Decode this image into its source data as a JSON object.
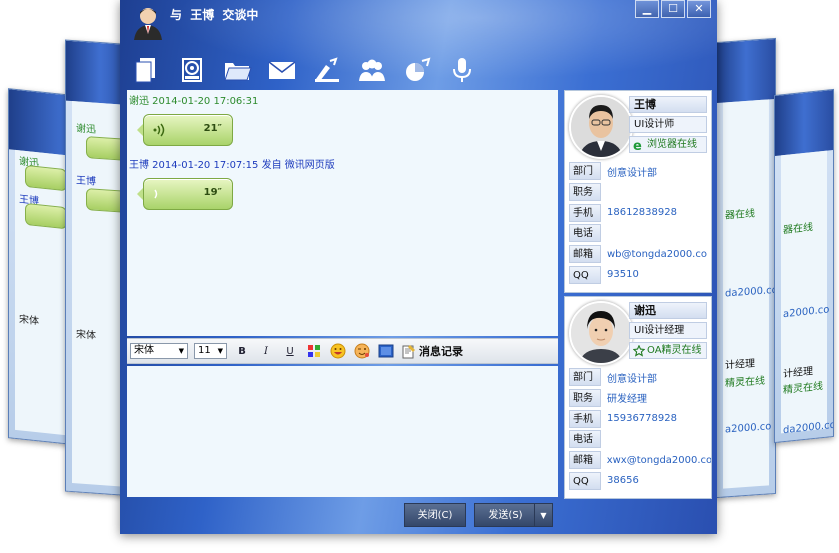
{
  "window": {
    "title_prefix": "与",
    "title_name": "王博",
    "title_suffix": "交谈中",
    "min_label": "▁",
    "max_label": "☐",
    "close_label": "✕"
  },
  "toolbar": {
    "icons": [
      "files-icon",
      "hard-disk-icon",
      "folder-icon",
      "mail-icon",
      "broadcast-icon",
      "group-icon",
      "chart-icon",
      "microphone-icon"
    ]
  },
  "messages": [
    {
      "header": "谢迅 2014-01-20 17:06:31",
      "duration": "21″"
    },
    {
      "header": "王博 2014-01-20 17:07:15 发自 微讯网页版",
      "duration": "19″"
    }
  ],
  "format_bar": {
    "font": "宋体",
    "size": "11",
    "bold": "B",
    "italic": "I",
    "underline": "U",
    "history_label": "消息记录"
  },
  "buttons": {
    "close_label": "关闭(C)",
    "send_label": "发送(S)",
    "send_arrow": "▼"
  },
  "contacts": [
    {
      "name": "王博",
      "role": "UI设计师",
      "status": "浏览器在线",
      "status_icon": "browser-e-icon",
      "fields": [
        {
          "k": "部门",
          "v": "创意设计部"
        },
        {
          "k": "职务",
          "v": ""
        },
        {
          "k": "手机",
          "v": "18612838928"
        },
        {
          "k": "电话",
          "v": ""
        },
        {
          "k": "邮箱",
          "v": "wb@tongda2000.co"
        },
        {
          "k": "QQ",
          "v": "93510"
        }
      ]
    },
    {
      "name": "谢迅",
      "role": "UI设计经理",
      "status": "OA精灵在线",
      "status_icon": "star-icon",
      "fields": [
        {
          "k": "部门",
          "v": "创意设计部"
        },
        {
          "k": "职务",
          "v": "研发经理"
        },
        {
          "k": "手机",
          "v": "15936778928"
        },
        {
          "k": "电话",
          "v": ""
        },
        {
          "k": "邮箱",
          "v": "xwx@tongda2000.co"
        },
        {
          "k": "QQ",
          "v": "38656"
        }
      ]
    }
  ],
  "background": {
    "left1_name": "谢迅",
    "left1_name2": "王博",
    "left1_font": "宋体",
    "left2_name": "谢迅",
    "left2_name2": "王博",
    "left2_font": "宋体",
    "right1_status": "器在线",
    "right1_role": "计经理",
    "right1_status2": "精灵在线",
    "right1_email": "da2000.co",
    "right1_email2": "a2000.co",
    "right2_status": "器在线",
    "right2_email": "a2000.co",
    "right2_role": "计经理",
    "right2_status2": "精灵在线",
    "right2_email2": "da2000.co"
  },
  "colors": {
    "accent": "#2f62c8",
    "chat_bg": "#f0f8fd",
    "voice_green": "#a9d36a",
    "link_blue": "#2a62c0",
    "online_green": "#1f7a1f"
  }
}
